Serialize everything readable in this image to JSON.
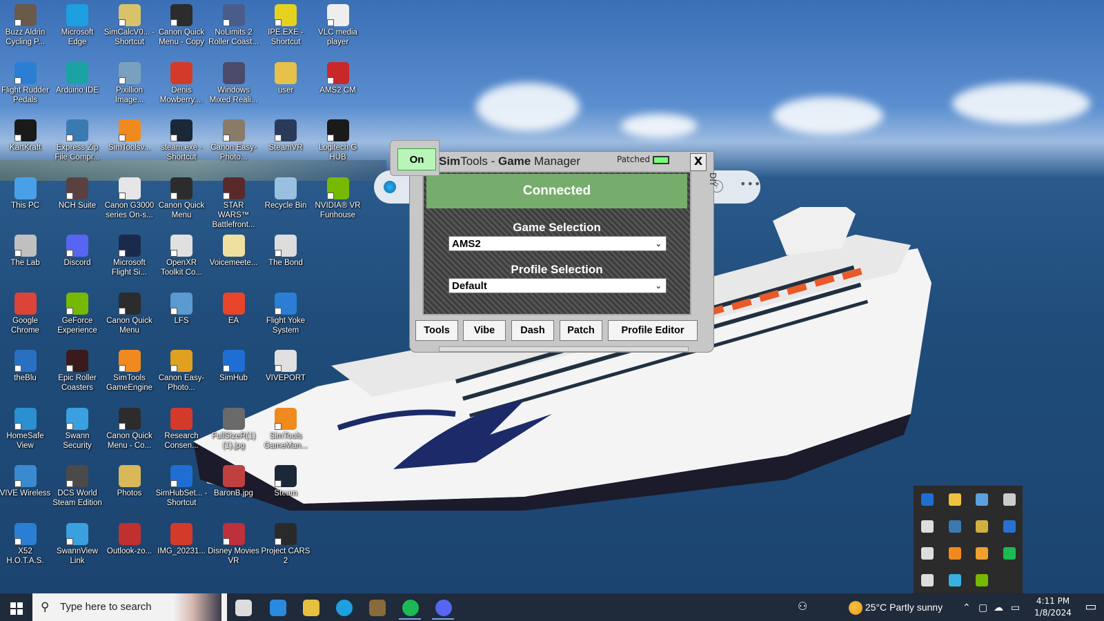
{
  "desktop_icons": [
    {
      "label": "Buzz Aldrin Cycling P...",
      "icon": "cycling-app-icon",
      "color": "#6a5a4a",
      "shortcut": true
    },
    {
      "label": "Microsoft Edge",
      "icon": "edge-icon",
      "color": "#1e9fe0",
      "shortcut": false
    },
    {
      "label": "SimCalcV0... - Shortcut",
      "icon": "simcalc-icon",
      "color": "#d9c36a",
      "shortcut": true
    },
    {
      "label": "Canon Quick Menu - Copy",
      "icon": "canon-quick-menu-icon",
      "color": "#2c2c2c",
      "shortcut": true
    },
    {
      "label": "NoLimits 2 Roller Coast...",
      "icon": "nolimits-icon",
      "color": "#4a5c8a",
      "shortcut": true
    },
    {
      "label": "IPE.EXE - Shortcut",
      "icon": "ipe-icon",
      "color": "#e6d21e",
      "shortcut": true
    },
    {
      "label": "VLC media player",
      "icon": "file-icon",
      "color": "#eeeeee",
      "shortcut": true
    },
    {
      "label": "Flight Rudder Pedals",
      "icon": "flight-rudder-icon",
      "color": "#2a7fd4",
      "shortcut": true
    },
    {
      "label": "Arduino IDE",
      "icon": "arduino-icon",
      "color": "#19a3a3",
      "shortcut": false
    },
    {
      "label": "Pixillion Image...",
      "icon": "pixillion-icon",
      "color": "#7aa0c0",
      "shortcut": true
    },
    {
      "label": "Denis Mowberry....",
      "icon": "pdf-icon",
      "color": "#d43a2a",
      "shortcut": false
    },
    {
      "label": "Windows Mixed Reali...",
      "icon": "mixed-reality-icon",
      "color": "#4a4a6a",
      "shortcut": false
    },
    {
      "label": "user",
      "icon": "user-folder-icon",
      "color": "#e6c24a",
      "shortcut": false
    },
    {
      "label": "AMS2 CM",
      "icon": "ams2-icon",
      "color": "#c8282a",
      "shortcut": true
    },
    {
      "label": "KartKraft",
      "icon": "kartkraft-icon",
      "color": "#1a1a1a",
      "shortcut": true
    },
    {
      "label": "Express Zip File Compr...",
      "icon": "express-zip-icon",
      "color": "#3a7ab0",
      "shortcut": true
    },
    {
      "label": "SimToolsv...",
      "icon": "simtools-icon",
      "color": "#f08a1e",
      "shortcut": true
    },
    {
      "label": "steam.exe - Shortcut",
      "icon": "steam-icon",
      "color": "#1b2838",
      "shortcut": true
    },
    {
      "label": "Canon Easy-Photo...",
      "icon": "canon-photo-icon",
      "color": "#8a7a6a",
      "shortcut": true
    },
    {
      "label": "SteamVR",
      "icon": "steamvr-icon",
      "color": "#2a3a5a",
      "shortcut": true
    },
    {
      "label": "Logitech G HUB",
      "icon": "logitech-icon",
      "color": "#1a1a1a",
      "shortcut": true
    },
    {
      "label": "This PC",
      "icon": "this-pc-icon",
      "color": "#4aa0e6",
      "shortcut": false
    },
    {
      "label": "NCH Suite",
      "icon": "nch-icon",
      "color": "#5a4040",
      "shortcut": true
    },
    {
      "label": "Canon G3000 series On-s...",
      "icon": "canon-doc-icon",
      "color": "#e6e6e6",
      "shortcut": true
    },
    {
      "label": "Canon Quick Menu",
      "icon": "canon-quick-menu-icon",
      "color": "#2c2c2c",
      "shortcut": true
    },
    {
      "label": "STAR WARS™ Battlefront...",
      "icon": "star-wars-icon",
      "color": "#5a2a2a",
      "shortcut": true
    },
    {
      "label": "Recycle Bin",
      "icon": "recycle-bin-icon",
      "color": "#9ac0e0",
      "shortcut": false
    },
    {
      "label": "NVIDIA® VR Funhouse",
      "icon": "nvidia-icon",
      "color": "#76b900",
      "shortcut": true
    },
    {
      "label": "The Lab",
      "icon": "the-lab-icon",
      "color": "#c0c0c0",
      "shortcut": true
    },
    {
      "label": "Discord",
      "icon": "discord-icon",
      "color": "#5865f2",
      "shortcut": true
    },
    {
      "label": "Microsoft Flight Si...",
      "icon": "flight-sim-icon",
      "color": "#1a2a4a",
      "shortcut": true
    },
    {
      "label": "OpenXR Toolkit Co...",
      "icon": "openxr-icon",
      "color": "#e0e0e0",
      "shortcut": true
    },
    {
      "label": "Voicemeete...",
      "icon": "file-icon",
      "color": "#f0e0a0",
      "shortcut": false
    },
    {
      "label": "The Bond",
      "icon": "file-icon",
      "color": "#dddddd",
      "shortcut": true
    },
    {
      "label": "",
      "icon": "",
      "color": "",
      "shortcut": false
    },
    {
      "label": "Google Chrome",
      "icon": "chrome-icon",
      "color": "#db4437",
      "shortcut": false
    },
    {
      "label": "GeForce Experience",
      "icon": "geforce-icon",
      "color": "#76b900",
      "shortcut": true
    },
    {
      "label": "Canon Quick Menu",
      "icon": "canon-quick-menu-icon",
      "color": "#2c2c2c",
      "shortcut": true
    },
    {
      "label": "LFS",
      "icon": "lfs-icon",
      "color": "#5a9ad0",
      "shortcut": true
    },
    {
      "label": "EA",
      "icon": "ea-icon",
      "color": "#e8442a",
      "shortcut": false
    },
    {
      "label": "Flight Yoke System",
      "icon": "flight-yoke-icon",
      "color": "#2a7fd4",
      "shortcut": true
    },
    {
      "label": "",
      "icon": "",
      "color": "",
      "shortcut": false
    },
    {
      "label": "theBlu",
      "icon": "theblu-icon",
      "color": "#2a70c0",
      "shortcut": true
    },
    {
      "label": "Epic Roller Coasters",
      "icon": "epic-roller-icon",
      "color": "#3a1a1a",
      "shortcut": true
    },
    {
      "label": "SimTools GameEngine",
      "icon": "simtools-engine-icon",
      "color": "#f08a1e",
      "shortcut": true
    },
    {
      "label": "Canon Easy-Photo...",
      "icon": "canon-photo-icon",
      "color": "#e0a020",
      "shortcut": true
    },
    {
      "label": "SimHub",
      "icon": "simhub-icon",
      "color": "#1f6ed4",
      "shortcut": true
    },
    {
      "label": "VIVEPORT",
      "icon": "viveport-icon",
      "color": "#e0e0e0",
      "shortcut": true
    },
    {
      "label": "",
      "icon": "",
      "color": "",
      "shortcut": false
    },
    {
      "label": "HomeSafe View",
      "icon": "homesafe-icon",
      "color": "#2a90d0",
      "shortcut": true
    },
    {
      "label": "Swann Security",
      "icon": "swann-icon",
      "color": "#3aa0e0",
      "shortcut": true
    },
    {
      "label": "Canon Quick Menu - Co...",
      "icon": "canon-quick-menu-icon",
      "color": "#2c2c2c",
      "shortcut": true
    },
    {
      "label": "Research Consen...",
      "icon": "pdf-icon",
      "color": "#d43a2a",
      "shortcut": false
    },
    {
      "label": "FullSizeR(1) (1).jpg",
      "icon": "image-file-icon",
      "color": "#6a6a6a",
      "shortcut": false
    },
    {
      "label": "SimTools GameMan...",
      "icon": "simtools-icon",
      "color": "#f08a1e",
      "shortcut": true
    },
    {
      "label": "",
      "icon": "",
      "color": "",
      "shortcut": false
    },
    {
      "label": "VIVE Wireless",
      "icon": "vive-wireless-icon",
      "color": "#3a8ad0",
      "shortcut": true
    },
    {
      "label": "DCS World Steam Edition",
      "icon": "dcs-icon",
      "color": "#4a4a4a",
      "shortcut": true
    },
    {
      "label": "Photos",
      "icon": "photos-folder-icon",
      "color": "#d9b85a",
      "shortcut": false
    },
    {
      "label": "SimHubSet... - Shortcut",
      "icon": "simhub-icon",
      "color": "#1f6ed4",
      "shortcut": true
    },
    {
      "label": "BaronB.jpg",
      "icon": "image-file-icon",
      "color": "#c04040",
      "shortcut": false
    },
    {
      "label": "Steam",
      "icon": "steam-icon",
      "color": "#1b2838",
      "shortcut": true
    },
    {
      "label": "",
      "icon": "",
      "color": "",
      "shortcut": false
    },
    {
      "label": "X52 H.O.T.A.S.",
      "icon": "x52-icon",
      "color": "#2a7fd4",
      "shortcut": true
    },
    {
      "label": "SwannView Link",
      "icon": "swannview-icon",
      "color": "#3aa0e0",
      "shortcut": true
    },
    {
      "label": "Outlook-zo...",
      "icon": "image-file-icon",
      "color": "#c03030",
      "shortcut": false
    },
    {
      "label": "IMG_20231...",
      "icon": "pdf-icon",
      "color": "#d43a2a",
      "shortcut": false
    },
    {
      "label": "Disney Movies VR",
      "icon": "disney-vr-icon",
      "color": "#c0303a",
      "shortcut": true
    },
    {
      "label": "Project CARS 2",
      "icon": "project-cars-icon",
      "color": "#2a2a2a",
      "shortcut": true
    },
    {
      "label": "",
      "icon": "",
      "color": "",
      "shortcut": false
    }
  ],
  "simtools": {
    "on_label": "On",
    "title_bold1": "Sim",
    "title_rest1": "Tools - ",
    "title_bold2": "Game",
    "title_rest2": " Manager",
    "patched_label": "Patched",
    "close_label": "X",
    "diy_label": "DIY",
    "status": "Connected",
    "game_selection_label": "Game Selection",
    "game_selection_value": "AMS2",
    "profile_selection_label": "Profile Selection",
    "profile_selection_value": "Default",
    "buttons": [
      "Tools",
      "Vibe",
      "Dash",
      "Patch",
      "Profile Editor"
    ],
    "status_color": "#76ad6c",
    "on_color": "#b9f5b9"
  },
  "tray_popup_icons": [
    {
      "icon": "simhub-tray-icon",
      "color": "#1f6ed4"
    },
    {
      "icon": "shield-tray-icon",
      "color": "#f0c040"
    },
    {
      "icon": "steam-tray-icon",
      "color": "#5aa0e0"
    },
    {
      "icon": "power-tray-icon",
      "color": "#cccccc"
    },
    {
      "icon": "speaker-tray-icon",
      "color": "#dddddd"
    },
    {
      "icon": "express-zip-tray-icon",
      "color": "#3a7ab0"
    },
    {
      "icon": "canon-tray-icon",
      "color": "#d0b040"
    },
    {
      "icon": "s-tray-icon",
      "color": "#2a70d0"
    },
    {
      "icon": "logitech-tray-icon",
      "color": "#dddddd"
    },
    {
      "icon": "simtools-tray-icon",
      "color": "#f08a1e"
    },
    {
      "icon": "simtools-engine-tray-icon",
      "color": "#f0a030"
    },
    {
      "icon": "spotify-tray-icon",
      "color": "#1db954"
    },
    {
      "icon": "discord-tray-icon",
      "color": "#dddddd"
    },
    {
      "icon": "edge-tray-icon",
      "color": "#3ab0e0"
    },
    {
      "icon": "nvidia-tray-icon",
      "color": "#76b900"
    }
  ],
  "taskbar": {
    "search_placeholder": "Type here to search",
    "apps": [
      {
        "icon": "task-view-icon",
        "color": "#dddddd",
        "active": false
      },
      {
        "icon": "mail-icon",
        "color": "#2a8ae0",
        "active": false
      },
      {
        "icon": "file-explorer-icon",
        "color": "#e8c040",
        "active": false
      },
      {
        "icon": "edge-icon",
        "color": "#1e9fe0",
        "active": false
      },
      {
        "icon": "game-app-icon",
        "color": "#8a6a3a",
        "active": false
      },
      {
        "icon": "spotify-icon",
        "color": "#1db954",
        "active": true
      },
      {
        "icon": "discord-icon",
        "color": "#5865f2",
        "active": true
      }
    ],
    "weather_temp": "25°C",
    "weather_desc": "Partly sunny",
    "time": "4:11 PM",
    "date": "1/8/2024"
  }
}
